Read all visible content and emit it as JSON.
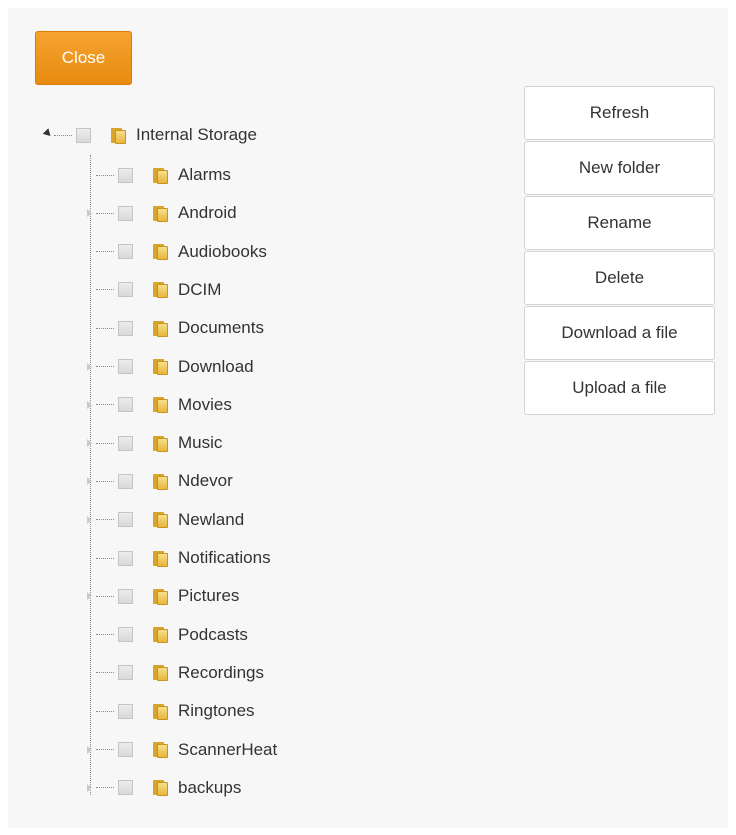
{
  "close_label": "Close",
  "root": {
    "label": "Internal Storage"
  },
  "children": [
    {
      "label": "Alarms",
      "expandable": false
    },
    {
      "label": "Android",
      "expandable": true
    },
    {
      "label": "Audiobooks",
      "expandable": false
    },
    {
      "label": "DCIM",
      "expandable": false
    },
    {
      "label": "Documents",
      "expandable": false
    },
    {
      "label": "Download",
      "expandable": true
    },
    {
      "label": "Movies",
      "expandable": true
    },
    {
      "label": "Music",
      "expandable": true
    },
    {
      "label": "Ndevor",
      "expandable": true
    },
    {
      "label": "Newland",
      "expandable": true
    },
    {
      "label": "Notifications",
      "expandable": false
    },
    {
      "label": "Pictures",
      "expandable": true
    },
    {
      "label": "Podcasts",
      "expandable": false
    },
    {
      "label": "Recordings",
      "expandable": false
    },
    {
      "label": "Ringtones",
      "expandable": false
    },
    {
      "label": "ScannerHeat",
      "expandable": true
    },
    {
      "label": "backups",
      "expandable": true
    }
  ],
  "actions": {
    "refresh": "Refresh",
    "new_folder": "New folder",
    "rename": "Rename",
    "delete": "Delete",
    "download": "Download a file",
    "upload": "Upload a file"
  },
  "colors": {
    "accent": "#f0961e",
    "folder": "#e8b63c"
  }
}
